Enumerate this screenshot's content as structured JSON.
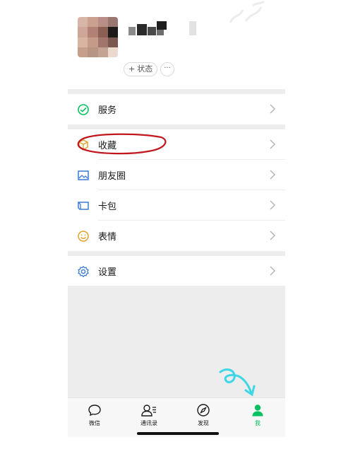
{
  "profile": {
    "status_label": "状态",
    "status_plus": "+",
    "more_label": "···"
  },
  "menu": {
    "services": "服务",
    "favorites": "收藏",
    "moments": "朋友圈",
    "cards": "卡包",
    "stickers": "表情",
    "settings": "设置"
  },
  "tabs": [
    {
      "label": "微信",
      "icon": "chat-icon"
    },
    {
      "label": "通讯录",
      "icon": "contacts-icon"
    },
    {
      "label": "发现",
      "icon": "compass-icon"
    },
    {
      "label": "我",
      "icon": "person-icon",
      "active": true
    }
  ],
  "colors": {
    "accent_green": "#07c160",
    "annotation_red": "#c0161c",
    "annotation_cyan": "#3fd6e6",
    "divider_gray": "#ededed"
  }
}
